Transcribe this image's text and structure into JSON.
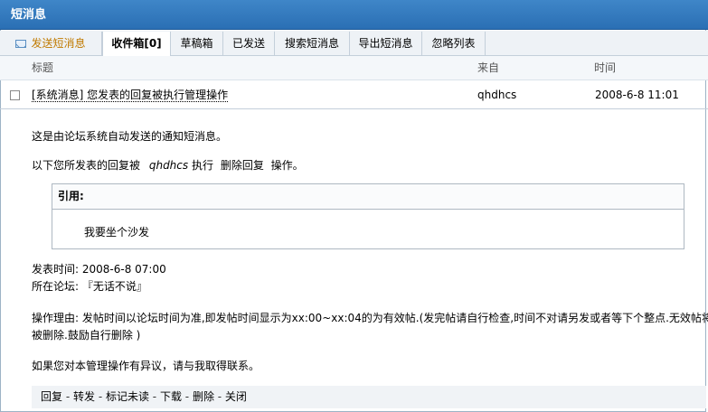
{
  "panel": {
    "title": "短消息"
  },
  "tabs": [
    {
      "label": "发送短消息"
    },
    {
      "label": "收件箱[0]"
    },
    {
      "label": "草稿箱"
    },
    {
      "label": "已发送"
    },
    {
      "label": "搜索短消息"
    },
    {
      "label": "导出短消息"
    },
    {
      "label": "忽略列表"
    }
  ],
  "table": {
    "headers": {
      "subject": "标题",
      "from": "来自",
      "time": "时间"
    },
    "message": {
      "subject": "[系统消息] 您发表的回复被执行管理操作",
      "from": "qhdhcs",
      "time": "2008-6-8 11:01"
    }
  },
  "body": {
    "line1": "这是由论坛系统自动发送的通知短消息。",
    "line2_prefix": "以下您所发表的回复被",
    "line2_user": "qhdhcs",
    "line2_mid": "执行",
    "line2_action": "删除回复",
    "line2_suffix": "操作。",
    "quote_label": "引用:",
    "quote_text": "我要坐个沙发",
    "post_time": "发表时间: 2008-6-8 07:00",
    "forum": "所在论坛: 『无话不说』",
    "reason_line1": "操作理由: 发帖时间以论坛时间为准,即发帖时间显示为xx:00~xx:04的为有效帖.(发完帖请自行检查,时间不对请另发或者等下个整点.无效帖将",
    "reason_line2": "被删除.鼓励自行删除   )",
    "contact": "如果您对本管理操作有异议，请与我取得联系。"
  },
  "actions": {
    "reply": "回复",
    "forward": "转发",
    "mark_unread": "标记未读",
    "download": "下载",
    "delete": "删除",
    "close": "关闭",
    "separator": " - "
  }
}
